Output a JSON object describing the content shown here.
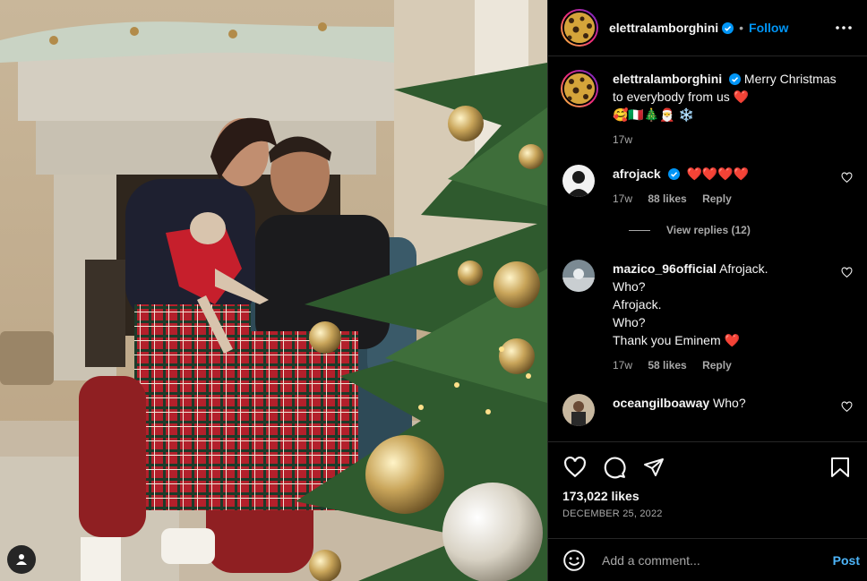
{
  "post": {
    "author": "elettralamborghini",
    "follow_label": "Follow",
    "separator": "•",
    "caption_text": "Merry Christmas to everybody from us",
    "caption_emojis": "❤️",
    "caption_line2": "🥰🇮🇹🎄🎅 ❄️",
    "caption_time": "17w",
    "likes": "173,022 likes",
    "date": "DECEMBER 25, 2022"
  },
  "comments": [
    {
      "user": "afrojack",
      "text": "",
      "hearts": "❤️❤️❤️❤️",
      "time": "17w",
      "likes": "88 likes",
      "reply": "Reply",
      "verified": true
    },
    {
      "user": "mazico_96official",
      "text": "Afrojack.",
      "line2": "Who?",
      "line3": "Afrojack.",
      "line4": "Who?",
      "line5": "Thank you Eminem",
      "hearts": "❤️",
      "time": "17w",
      "likes": "58 likes",
      "reply": "Reply"
    },
    {
      "user": "oceangilboaway",
      "text": "Who?"
    }
  ],
  "view_replies": "View replies (12)",
  "composer": {
    "placeholder": "Add a comment...",
    "post_label": "Post"
  },
  "icons": [
    "verified-badge-icon",
    "more-options-icon",
    "heart-icon",
    "comment-icon",
    "share-icon",
    "bookmark-icon",
    "emoji-icon",
    "user-tag-icon"
  ],
  "colors": {
    "accent": "#0095f6",
    "heart": "#ed4956",
    "background": "#000000",
    "muted": "#a8a8a8"
  }
}
